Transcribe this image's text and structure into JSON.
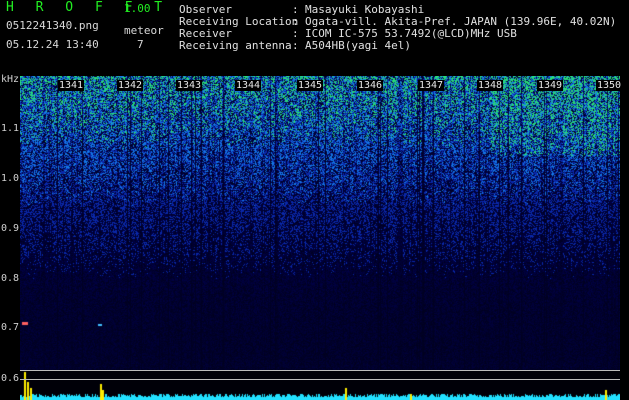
{
  "header": {
    "app_name": "H R O F F T",
    "app_version": "1.00",
    "filename": "0512241340.png",
    "datetime": "05.12.24 13:40",
    "meteor_label": "meteor",
    "meteor_count": "7",
    "info": [
      {
        "label": "Observer",
        "value": "Masayuki Kobayashi"
      },
      {
        "label": "Receiving Location",
        "value": "Ogata-vill. Akita-Pref. JAPAN (139.96E, 40.02N)"
      },
      {
        "label": "Receiver",
        "value": "ICOM IC-575 53.7492(@LCD)MHz USB"
      },
      {
        "label": "Receiving antenna",
        "value": "A504HB(yagi 4el)"
      }
    ]
  },
  "spectrogram": {
    "y_unit": "kHz",
    "y_ticks": [
      "1.1",
      "1.0",
      "0.9",
      "0.8",
      "0.7",
      "0.6"
    ],
    "time_ticks": [
      "1341",
      "1342",
      "1343",
      "1344",
      "1345",
      "1346",
      "1347",
      "1348",
      "1349",
      "1350"
    ]
  }
}
